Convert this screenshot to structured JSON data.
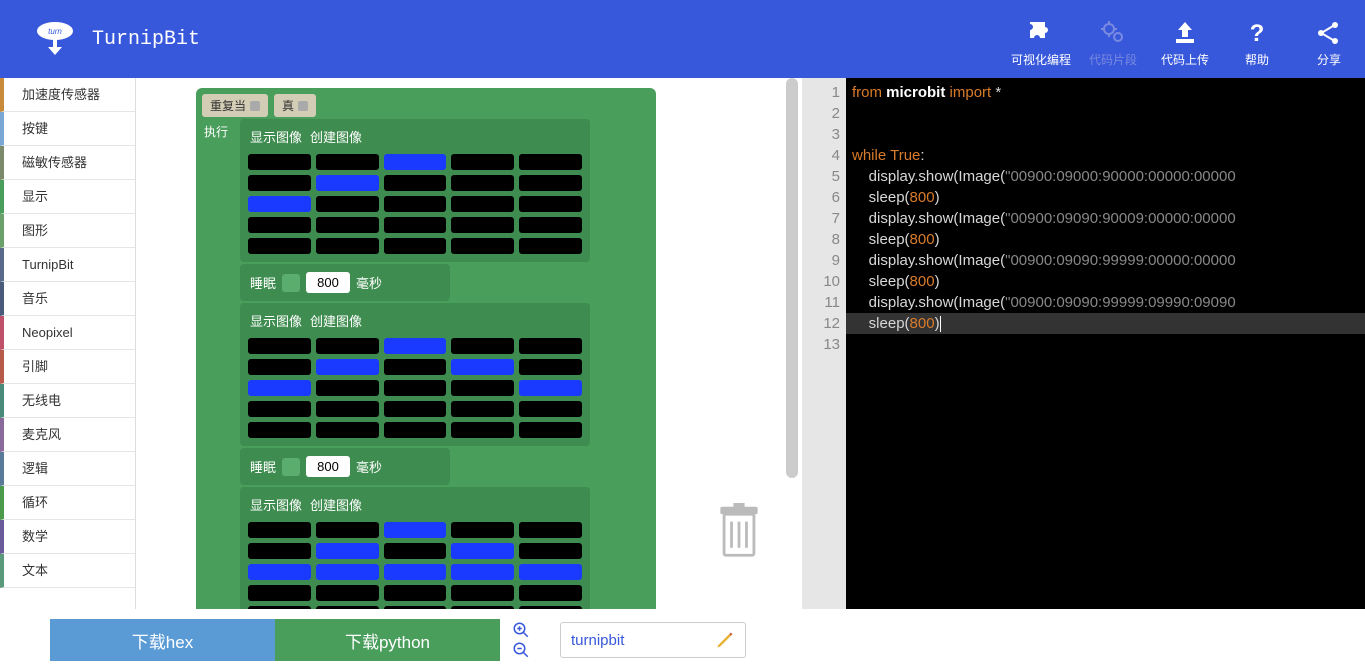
{
  "header": {
    "title": "TurnipBit",
    "buttons": [
      {
        "icon": "puzzle",
        "label": "可视化编程",
        "disabled": false
      },
      {
        "icon": "gears",
        "label": "代码片段",
        "disabled": true
      },
      {
        "icon": "upload",
        "label": "代码上传",
        "disabled": false
      },
      {
        "icon": "help",
        "label": "帮助",
        "disabled": false
      },
      {
        "icon": "share",
        "label": "分享",
        "disabled": false
      }
    ]
  },
  "sidebar": {
    "items": [
      {
        "label": "加速度传感器",
        "color": "#c78b3a"
      },
      {
        "label": "按键",
        "color": "#7aa8d4"
      },
      {
        "label": "磁敏传感器",
        "color": "#7a8a6a"
      },
      {
        "label": "显示",
        "color": "#4a9e5c"
      },
      {
        "label": "图形",
        "color": "#6aa06a"
      },
      {
        "label": "TurnipBit",
        "color": "#5a6a8a"
      },
      {
        "label": "音乐",
        "color": "#4a5a7a"
      },
      {
        "label": "Neopixel",
        "color": "#c0506a"
      },
      {
        "label": "引脚",
        "color": "#b85a4a"
      },
      {
        "label": "无线电",
        "color": "#4a8a7a"
      },
      {
        "label": "麦克风",
        "color": "#8a6a9a"
      },
      {
        "label": "逻辑",
        "color": "#5a7a9a"
      },
      {
        "label": "循环",
        "color": "#4a9a4a"
      },
      {
        "label": "数学",
        "color": "#6a5a9a"
      },
      {
        "label": "文本",
        "color": "#5a9a7a"
      }
    ]
  },
  "blocks": {
    "while_label": "重复当",
    "true_label": "真",
    "exec_label": "执行",
    "show_label": "显示图像",
    "create_label": "创建图像",
    "sleep_label": "睡眠",
    "sleep_value": "800",
    "sleep_unit": "毫秒",
    "images": [
      {
        "grid": "00900:09000:90000:00000:00000"
      },
      {
        "grid": "00900:09090:90009:00000:00000"
      },
      {
        "grid": "00900:09090:99999:00000:00000"
      }
    ]
  },
  "code": {
    "lines": [
      {
        "n": 1,
        "tokens": [
          [
            "kw",
            "from"
          ],
          [
            "sp",
            " "
          ],
          [
            "bi",
            "microbit"
          ],
          [
            "sp",
            " "
          ],
          [
            "kw",
            "import"
          ],
          [
            "sp",
            " *"
          ]
        ]
      },
      {
        "n": 2,
        "tokens": []
      },
      {
        "n": 3,
        "tokens": []
      },
      {
        "n": 4,
        "tokens": [
          [
            "kw",
            "while"
          ],
          [
            "sp",
            " "
          ],
          [
            "kw",
            "True"
          ],
          [
            "id",
            ":"
          ]
        ]
      },
      {
        "n": 5,
        "tokens": [
          [
            "sp",
            "    "
          ],
          [
            "id",
            "display.show(Image("
          ],
          [
            "str",
            "\"00900:09000:90000:00000:00000"
          ]
        ]
      },
      {
        "n": 6,
        "tokens": [
          [
            "sp",
            "    "
          ],
          [
            "id",
            "sleep("
          ],
          [
            "num",
            "800"
          ],
          [
            "id",
            ")"
          ]
        ]
      },
      {
        "n": 7,
        "tokens": [
          [
            "sp",
            "    "
          ],
          [
            "id",
            "display.show(Image("
          ],
          [
            "str",
            "\"00900:09090:90009:00000:00000"
          ]
        ]
      },
      {
        "n": 8,
        "tokens": [
          [
            "sp",
            "    "
          ],
          [
            "id",
            "sleep("
          ],
          [
            "num",
            "800"
          ],
          [
            "id",
            ")"
          ]
        ]
      },
      {
        "n": 9,
        "tokens": [
          [
            "sp",
            "    "
          ],
          [
            "id",
            "display.show(Image("
          ],
          [
            "str",
            "\"00900:09090:99999:00000:00000"
          ]
        ]
      },
      {
        "n": 10,
        "tokens": [
          [
            "sp",
            "    "
          ],
          [
            "id",
            "sleep("
          ],
          [
            "num",
            "800"
          ],
          [
            "id",
            ")"
          ]
        ]
      },
      {
        "n": 11,
        "tokens": [
          [
            "sp",
            "    "
          ],
          [
            "id",
            "display.show(Image("
          ],
          [
            "str",
            "\"00900:09090:99999:09990:09090"
          ]
        ]
      },
      {
        "n": 12,
        "tokens": [
          [
            "sp",
            "    "
          ],
          [
            "id",
            "sleep("
          ],
          [
            "num",
            "800"
          ],
          [
            "id",
            ")"
          ]
        ],
        "hl": true,
        "cursor": true
      },
      {
        "n": 13,
        "tokens": []
      }
    ]
  },
  "footer": {
    "btn_hex": "下载hex",
    "btn_py": "下载python",
    "filename": "turnipbit"
  }
}
